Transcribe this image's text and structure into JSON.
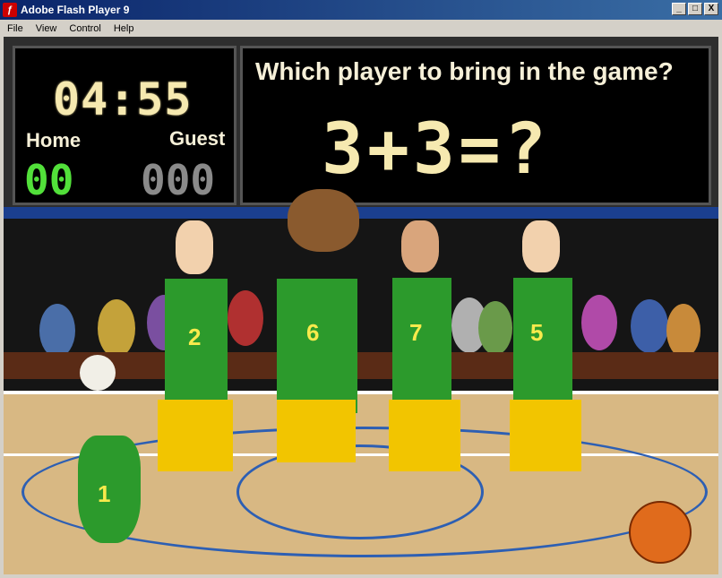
{
  "window": {
    "title": "Adobe Flash Player 9",
    "controls": [
      "_",
      "□",
      "X"
    ]
  },
  "menu": {
    "items": [
      "File",
      "View",
      "Control",
      "Help"
    ]
  },
  "scoreboard": {
    "clock": "04:55",
    "home_label": "Home",
    "guest_label": "Guest",
    "home_score": "00",
    "guest_score": "000",
    "question": "Which player to bring in the game?",
    "equation": "3+3=?"
  },
  "players": [
    {
      "number": "1"
    },
    {
      "number": "2"
    },
    {
      "number": "6"
    },
    {
      "number": "7"
    },
    {
      "number": "5"
    }
  ],
  "colors": {
    "jersey": "#2c9a2c",
    "shorts": "#f2c500",
    "number": "#f8ea4c",
    "home_digits": "#52e03a",
    "guest_digits": "#8a8a8a"
  }
}
